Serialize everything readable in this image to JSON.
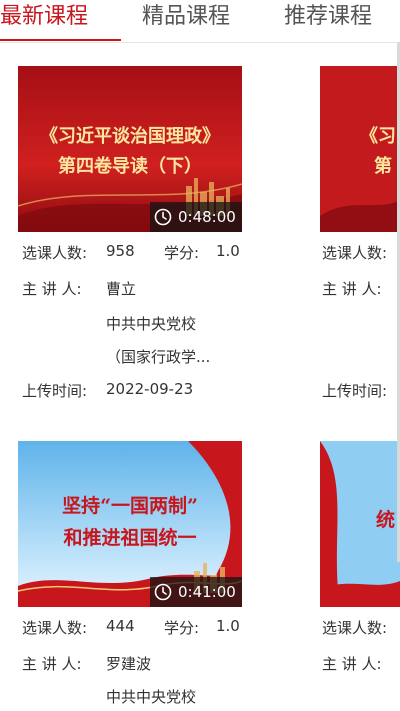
{
  "tabs": [
    {
      "label": "最新课程"
    },
    {
      "label": "精品课程"
    },
    {
      "label": "推荐课程"
    }
  ],
  "labels": {
    "students": "选课人数:",
    "credits": "学分:",
    "lecturer": "主 讲 人:",
    "upload_time": "上传时间:"
  },
  "courses": [
    {
      "title_line1": "《习近平谈治国理政》",
      "title_line2": "第四卷导读（下）",
      "duration": "0:48:00",
      "students": "958",
      "credits": "1.0",
      "lecturer": "曹立",
      "org_line1": "中共中央党校",
      "org_line2": "（国家行政学...",
      "upload_date": "2022-09-23"
    },
    {
      "title_line1": "坚持“一国两制”",
      "title_line2": "和推进祖国统一",
      "duration": "0:41:00",
      "students": "444",
      "credits": "1.0",
      "lecturer": "罗建波",
      "org_line1": "中共中央党校"
    }
  ],
  "peek": {
    "title_1a": "《习",
    "title_1b": "第",
    "title_2": "统"
  },
  "colors": {
    "accent": "#c8161d",
    "thumb_red": "#c8161d",
    "thumb_blue": "#7fc4ee",
    "title_gold": "#fbe6a0"
  }
}
